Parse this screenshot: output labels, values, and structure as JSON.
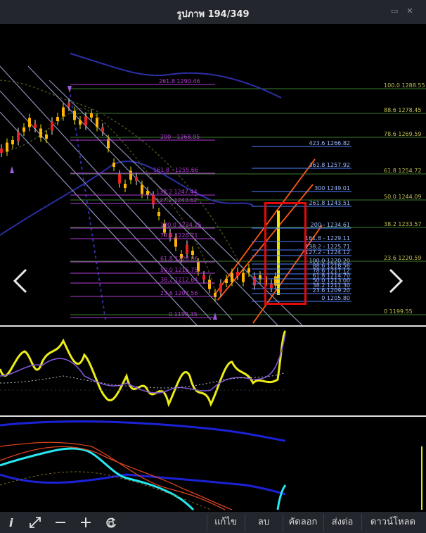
{
  "window": {
    "title": "รูปภาพ 194/349"
  },
  "chart_overlay": {
    "left_fib_labels": [
      "261.8 1290.46",
      "200 - 1268.95",
      "161.8 - 1255.66",
      "138.2 1247.44",
      "127.2 1243.62",
      "100.0 1234.15",
      "78.6 1226.71",
      "61.8 1220.86",
      "50.0 1216.75",
      "38.2 1212.64",
      "23.6 1207.56",
      "0 1199.35"
    ],
    "right_fib_labels": [
      "423.6 1266.82",
      "361.8 1257.92",
      "300 1249.01",
      "261.8 1243.51",
      "200 - 1234.61",
      "161.8 - 1229.11",
      "138.2 - 1225.71",
      "127.2 - 1224.12",
      "100.0 1220.20",
      "88.6 1218.56",
      "78.6 1217.12",
      "61.8 1214.70",
      "50.0 1213.00",
      "38.2 1211.30",
      "23.6 1209.20",
      "0 1205.80"
    ],
    "edge_fib_labels": [
      "100.0 1288.55",
      "88.6 1278.45",
      "78.6 1269.59",
      "61.8 1254.72",
      "50.0 1244.09",
      "38.2 1233.57",
      "23.6 1220.59",
      "0 1199.55"
    ]
  },
  "toolbar": {
    "info_icon": "info-icon",
    "expand_icon": "expand-icon",
    "zoom_out_icon": "minus-icon",
    "zoom_in_icon": "plus-icon",
    "rotate_icon": "rotate-icon",
    "edit_label": "แก้ไข",
    "delete_label": "ลบ",
    "copy_label": "คัดลอก",
    "share_label": "ส่งต่อ",
    "download_label": "ดาวน์โหลด"
  },
  "colors": {
    "accent_red": "#e10b0b",
    "toolbar_bg": "#23272d",
    "fib_purple": "#b03bd6",
    "fib_blue": "#4d7fff",
    "fib_green": "#3d7d2e"
  }
}
